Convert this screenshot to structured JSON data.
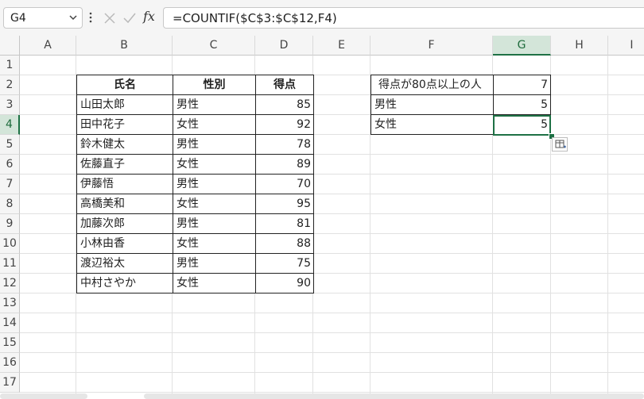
{
  "formula_bar": {
    "name_box": "G4",
    "formula": "=COUNTIF($C$3:$C$12,F4)",
    "fx_label": "fx"
  },
  "columns": [
    "A",
    "B",
    "C",
    "D",
    "E",
    "F",
    "G",
    "H",
    "I"
  ],
  "rows": [
    "1",
    "2",
    "3",
    "4",
    "5",
    "6",
    "7",
    "8",
    "9",
    "10",
    "11",
    "12",
    "13",
    "14",
    "15",
    "16",
    "17"
  ],
  "selected": {
    "column": "G",
    "row": "4"
  },
  "table": {
    "headers": [
      "氏名",
      "性別",
      "得点"
    ],
    "rows": [
      {
        "name": "山田太郎",
        "gender": "男性",
        "score": "85"
      },
      {
        "name": "田中花子",
        "gender": "女性",
        "score": "92"
      },
      {
        "name": "鈴木健太",
        "gender": "男性",
        "score": "78"
      },
      {
        "name": "佐藤直子",
        "gender": "女性",
        "score": "89"
      },
      {
        "name": "伊藤悟",
        "gender": "男性",
        "score": "70"
      },
      {
        "name": "高橋美和",
        "gender": "女性",
        "score": "95"
      },
      {
        "name": "加藤次郎",
        "gender": "男性",
        "score": "81"
      },
      {
        "name": "小林由香",
        "gender": "女性",
        "score": "88"
      },
      {
        "name": "渡辺裕太",
        "gender": "男性",
        "score": "75"
      },
      {
        "name": "中村さやか",
        "gender": "女性",
        "score": "90"
      }
    ]
  },
  "summary": [
    {
      "label": "得点が80点以上の人",
      "value": "7"
    },
    {
      "label": "男性",
      "value": "5"
    },
    {
      "label": "女性",
      "value": "5"
    }
  ],
  "colors": {
    "selection": "#1e7145",
    "header_selected": "#d3e5d9"
  }
}
